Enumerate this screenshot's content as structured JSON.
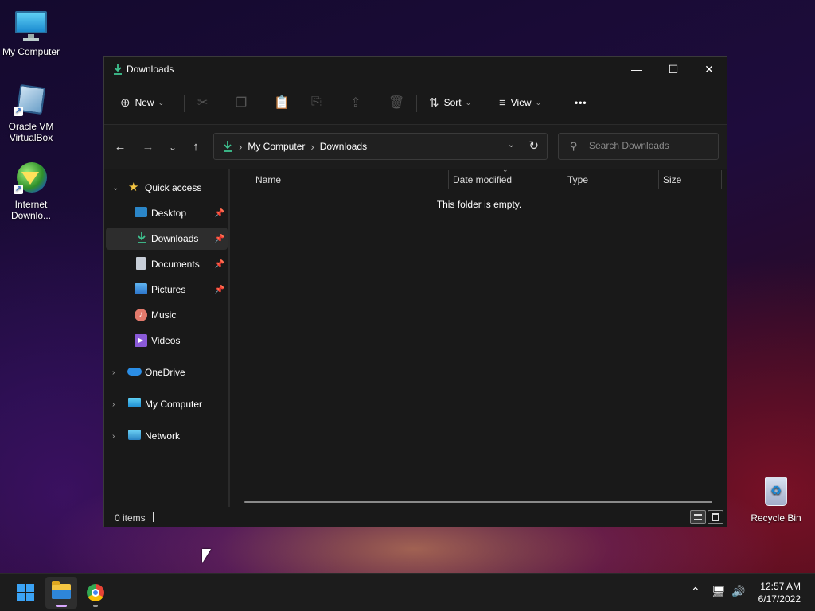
{
  "desktop": {
    "icons": [
      {
        "label": "My Computer",
        "icon": "monitor-icon"
      },
      {
        "label": "Oracle VM VirtualBox",
        "icon": "virtualbox-icon"
      },
      {
        "label": "Internet Downlo...",
        "icon": "idm-icon"
      },
      {
        "label": "Recycle Bin",
        "icon": "recycle-bin-icon"
      }
    ]
  },
  "window": {
    "title": "Downloads",
    "controls": {
      "minimize": "—",
      "maximize": "☐",
      "close": "✕"
    }
  },
  "commandbar": {
    "new_label": "New",
    "sort_label": "Sort",
    "view_label": "View",
    "more_label": "•••",
    "disabled_actions": [
      "cut",
      "copy",
      "paste",
      "rename",
      "share",
      "delete"
    ]
  },
  "navigation": {
    "back": "←",
    "forward": "→",
    "recent": "⌄",
    "up": "↑"
  },
  "addressbar": {
    "crumbs": [
      "My Computer",
      "Downloads"
    ]
  },
  "search": {
    "placeholder": "Search Downloads"
  },
  "navpane": {
    "quick_access": "Quick access",
    "items": [
      {
        "label": "Desktop",
        "pinned": true,
        "icon": "desktop-icon"
      },
      {
        "label": "Downloads",
        "pinned": true,
        "icon": "download-icon",
        "selected": true
      },
      {
        "label": "Documents",
        "pinned": true,
        "icon": "documents-icon"
      },
      {
        "label": "Pictures",
        "pinned": true,
        "icon": "pictures-icon"
      },
      {
        "label": "Music",
        "pinned": false,
        "icon": "music-icon"
      },
      {
        "label": "Videos",
        "pinned": false,
        "icon": "videos-icon"
      }
    ],
    "roots": [
      {
        "label": "OneDrive",
        "icon": "onedrive-icon"
      },
      {
        "label": "My Computer",
        "icon": "monitor-icon"
      },
      {
        "label": "Network",
        "icon": "network-icon"
      }
    ]
  },
  "content": {
    "columns": [
      "Name",
      "Date modified",
      "Type",
      "Size"
    ],
    "empty_message": "This folder is empty."
  },
  "statusbar": {
    "item_count": "0 items"
  },
  "taskbar": {
    "time": "12:57 AM",
    "date": "6/17/2022",
    "accent": "#3ba3f5"
  }
}
